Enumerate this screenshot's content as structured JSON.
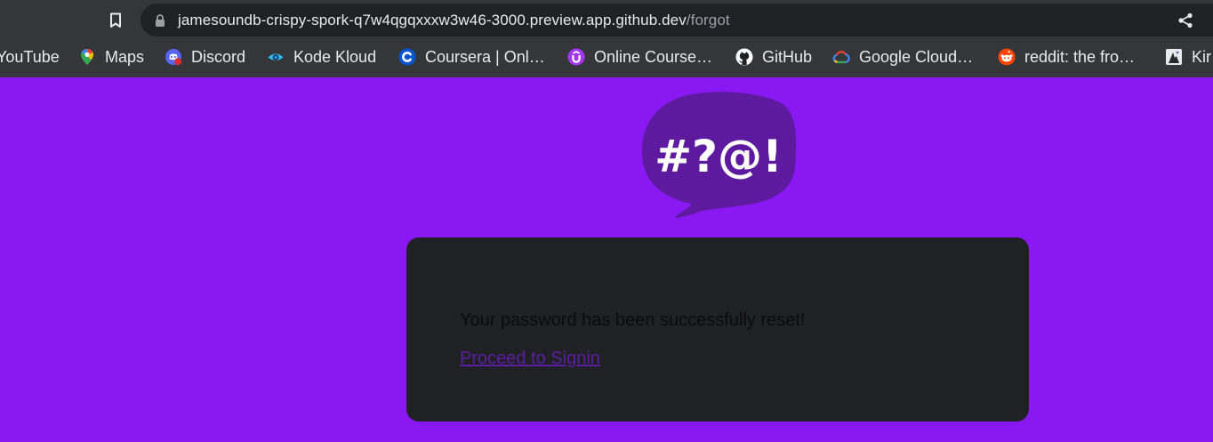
{
  "browser": {
    "url_host": "jamesoundb-crispy-spork-q7w4qgqxxxw3w46-3000.preview.app.github.dev",
    "url_path": "/forgot",
    "icons": {
      "bookmark": "bookmark-icon",
      "lock": "lock-icon",
      "share": "share-icon"
    }
  },
  "bookmarks": [
    {
      "label": "YouTube",
      "icon": "youtube-icon"
    },
    {
      "label": "Maps",
      "icon": "maps-icon"
    },
    {
      "label": "Discord",
      "icon": "discord-icon"
    },
    {
      "label": "Kode Kloud",
      "icon": "kodekloud-icon"
    },
    {
      "label": "Coursera | Onl…",
      "icon": "coursera-icon"
    },
    {
      "label": "Online Course…",
      "icon": "online-course-icon"
    },
    {
      "label": "GitHub",
      "icon": "github-icon"
    },
    {
      "label": "Google Cloud…",
      "icon": "google-cloud-icon"
    },
    {
      "label": "reddit: the fro…",
      "icon": "reddit-icon"
    },
    {
      "label": "Kir",
      "icon": "kir-icon"
    }
  ],
  "page": {
    "logo_text": "#?@!",
    "message": "Your password has been successfully reset!",
    "link_label": "Proceed to Signin"
  },
  "colors": {
    "background": "#8a18f3",
    "card": "#202124",
    "logo_bubble": "#5d1a9f",
    "link": "#5b1ea0"
  }
}
